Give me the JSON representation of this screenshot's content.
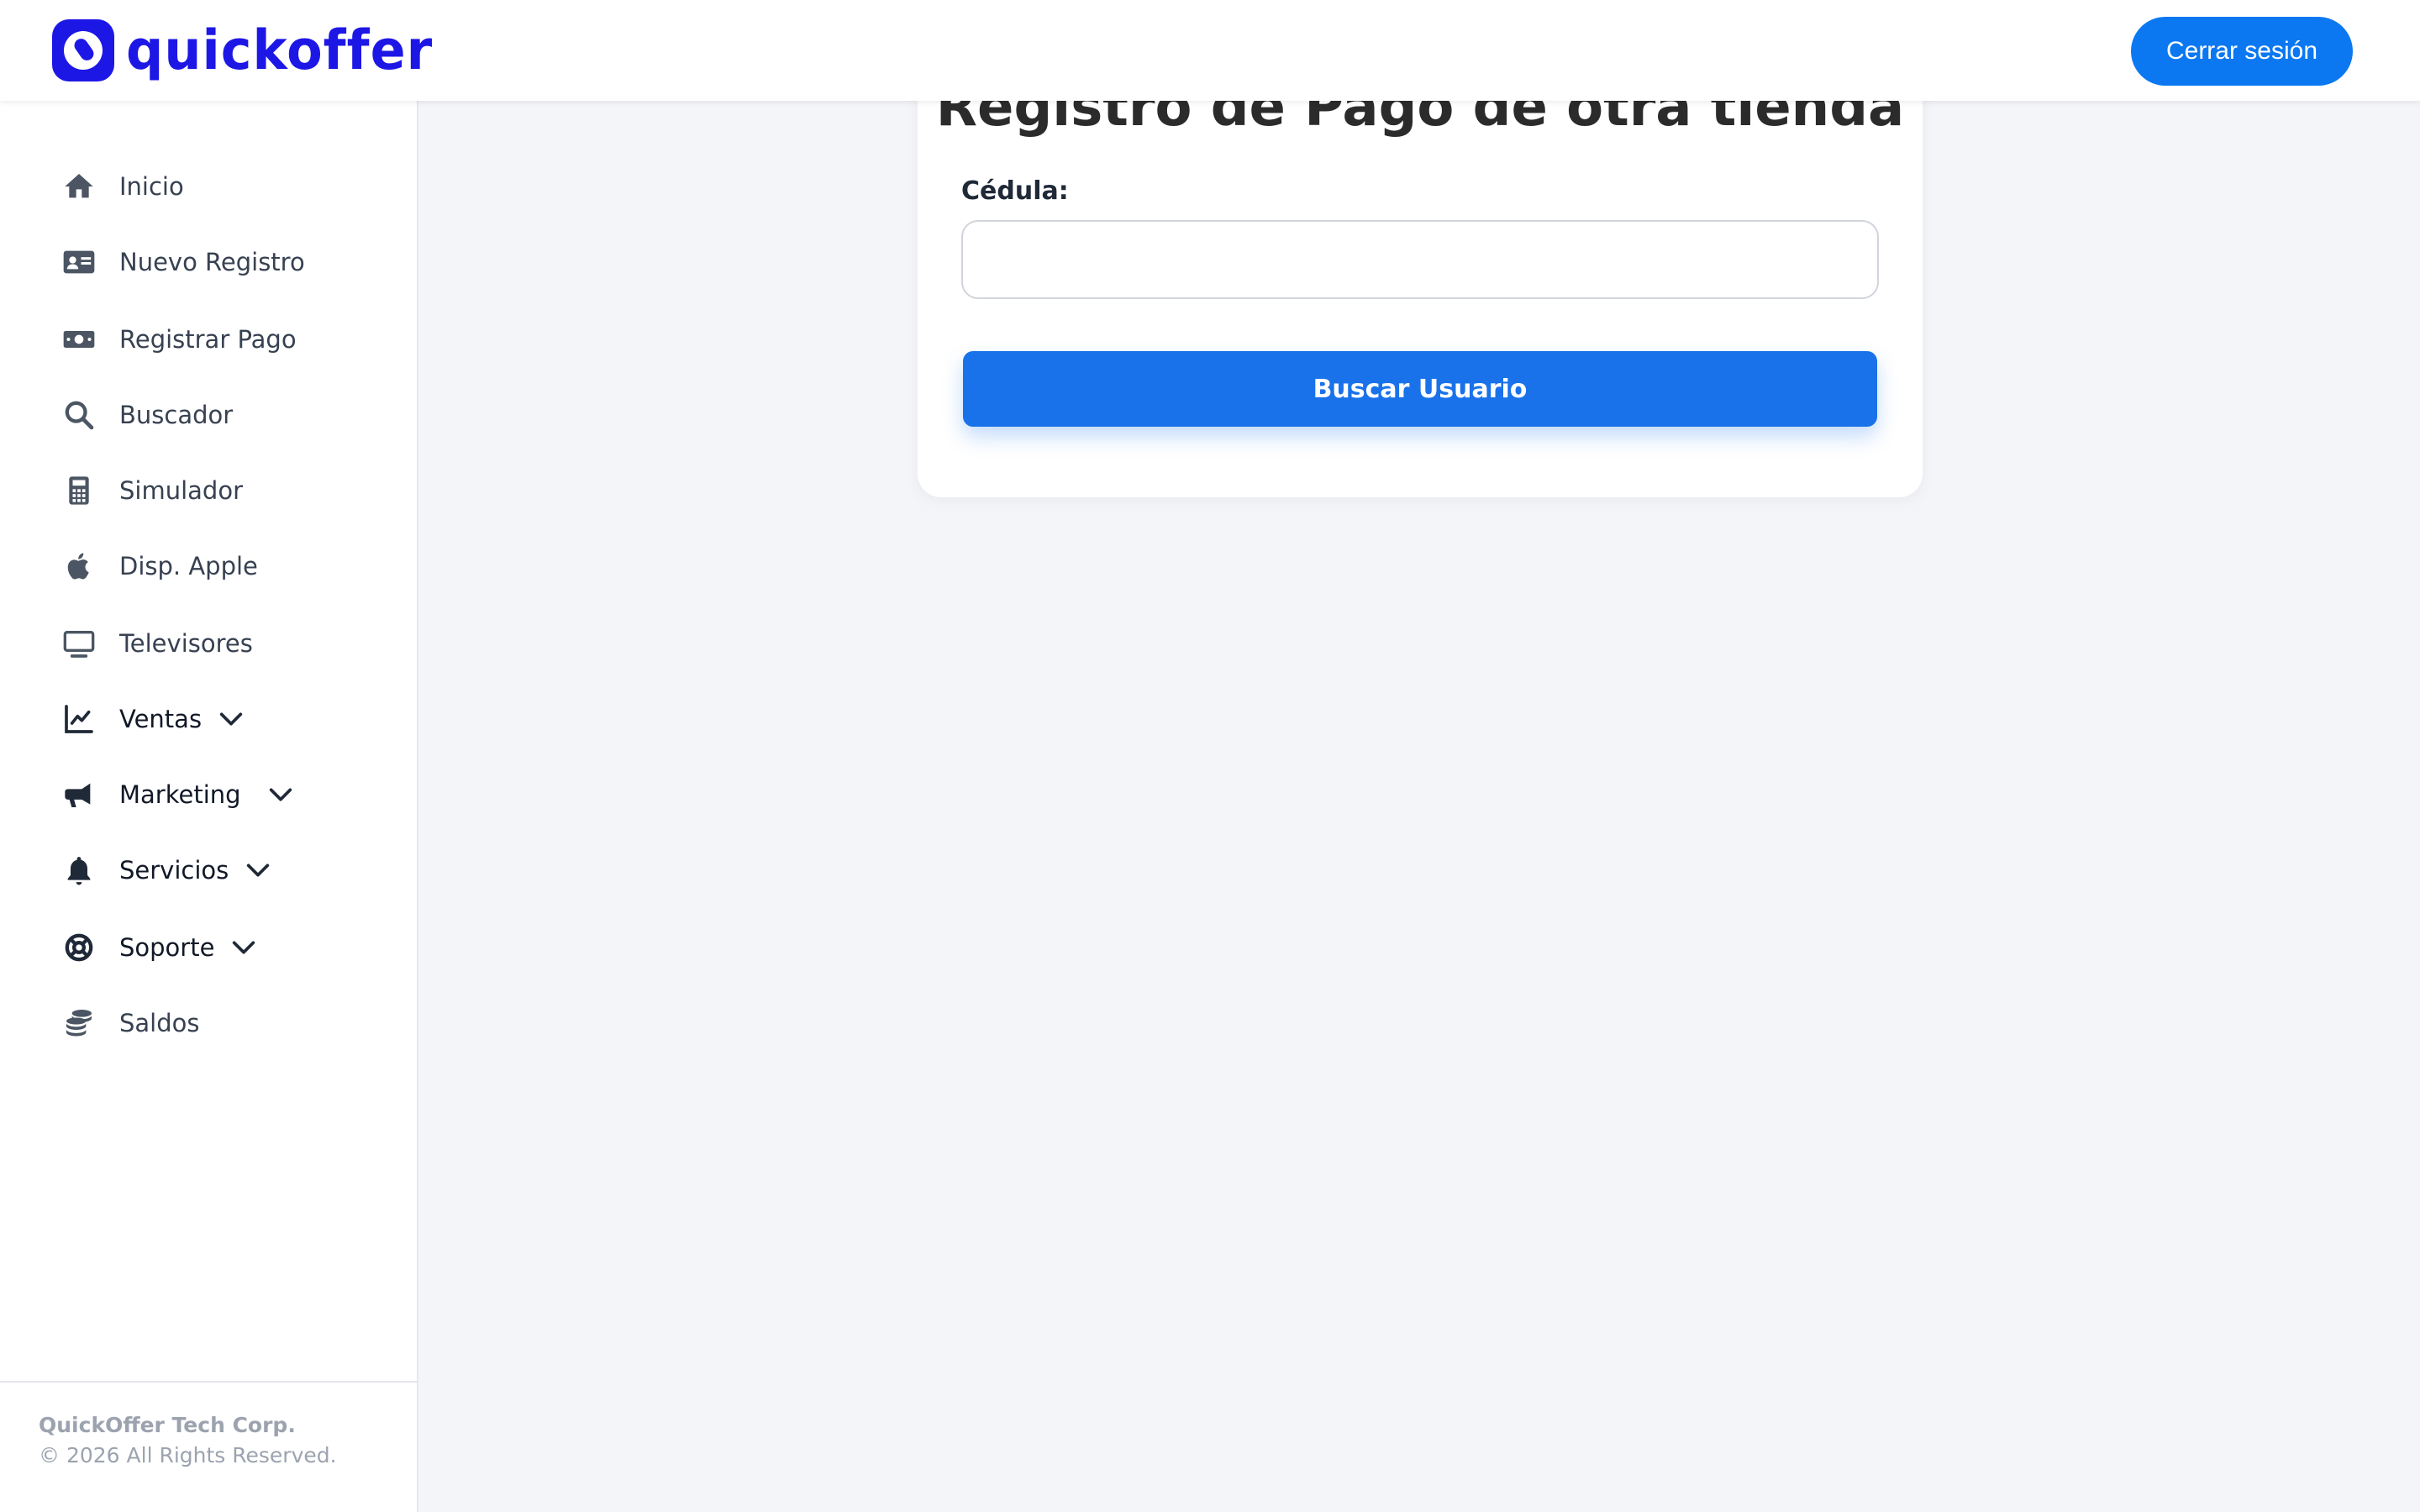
{
  "header": {
    "logo_text": "quickoffer",
    "logout_label": "Cerrar sesión"
  },
  "sidebar": {
    "items": [
      {
        "label": "Inicio",
        "icon": "home-icon"
      },
      {
        "label": "Nuevo Registro",
        "icon": "id-card-icon"
      },
      {
        "label": "Registrar Pago",
        "icon": "money-bill-icon"
      },
      {
        "label": "Buscador",
        "icon": "search-icon"
      },
      {
        "label": "Simulador",
        "icon": "calculator-icon"
      },
      {
        "label": "Disp. Apple",
        "icon": "apple-icon"
      },
      {
        "label": "Televisores",
        "icon": "tv-icon"
      },
      {
        "label": "Ventas",
        "icon": "chart-line-icon",
        "expandable": true
      },
      {
        "label": "Marketing",
        "icon": "megaphone-icon",
        "expandable": true
      },
      {
        "label": "Servicios",
        "icon": "bell-icon",
        "expandable": true
      },
      {
        "label": "Soporte",
        "icon": "lifebuoy-icon",
        "expandable": true
      },
      {
        "label": "Saldos",
        "icon": "coins-icon"
      }
    ],
    "footer": {
      "company": "QuickOffer Tech Corp.",
      "rights": "© 2026 All Rights Reserved."
    }
  },
  "main": {
    "title": "Registro de Pago de otra tienda",
    "field_label": "Cédula:",
    "field_value": "",
    "submit_label": "Buscar Usuario"
  },
  "colors": {
    "brand": "#1d17e6",
    "primary_button": "#1972ea",
    "logout_button": "#0b78f2",
    "background": "#f3f5f9"
  }
}
